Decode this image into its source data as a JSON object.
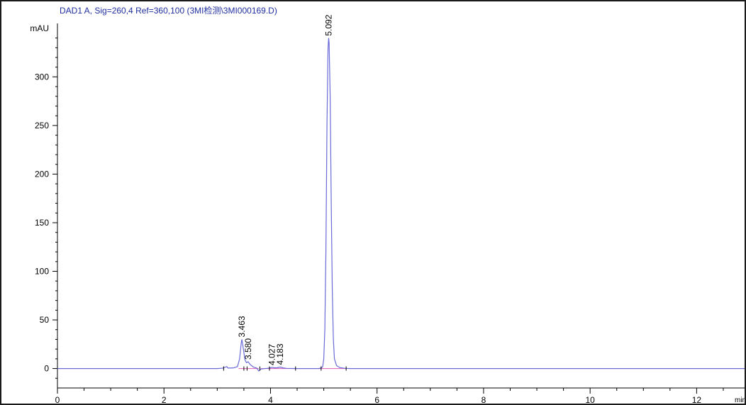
{
  "chart_data": {
    "type": "line",
    "title": "DAD1 A, Sig=260,4 Ref=360,100 (3MI检测\\3MI000169.D)",
    "ylabel": "mAU",
    "xlabel": "min",
    "xlim": [
      0,
      12.9
    ],
    "ylim": [
      -20,
      355
    ],
    "x_ticks": [
      0,
      2,
      4,
      6,
      8,
      10,
      12
    ],
    "y_ticks": [
      0,
      50,
      100,
      150,
      200,
      250,
      300
    ],
    "grid": false,
    "series": [
      {
        "color": "#6a6ad8",
        "points": [
          [
            0,
            0
          ],
          [
            3.0,
            0
          ],
          [
            3.1,
            0.4
          ],
          [
            3.18,
            2.0
          ],
          [
            3.2,
            0.5
          ],
          [
            3.3,
            0.6
          ],
          [
            3.38,
            2
          ],
          [
            3.42,
            10
          ],
          [
            3.45,
            26
          ],
          [
            3.463,
            30
          ],
          [
            3.48,
            24
          ],
          [
            3.52,
            9
          ],
          [
            3.55,
            6
          ],
          [
            3.58,
            7
          ],
          [
            3.62,
            4
          ],
          [
            3.68,
            1.5
          ],
          [
            3.74,
            0.5
          ],
          [
            3.78,
            -2.5
          ],
          [
            3.82,
            -0.5
          ],
          [
            3.9,
            0
          ],
          [
            3.97,
            0.4
          ],
          [
            4.027,
            1.2
          ],
          [
            4.08,
            0.7
          ],
          [
            4.13,
            0.9
          ],
          [
            4.183,
            1.5
          ],
          [
            4.24,
            0.6
          ],
          [
            4.3,
            0.2
          ],
          [
            4.5,
            0
          ],
          [
            4.9,
            0
          ],
          [
            4.95,
            0.5
          ],
          [
            4.98,
            2
          ],
          [
            5.0,
            10
          ],
          [
            5.02,
            40
          ],
          [
            5.04,
            120
          ],
          [
            5.06,
            250
          ],
          [
            5.08,
            330
          ],
          [
            5.092,
            340
          ],
          [
            5.1,
            335
          ],
          [
            5.12,
            280
          ],
          [
            5.14,
            170
          ],
          [
            5.16,
            80
          ],
          [
            5.18,
            30
          ],
          [
            5.2,
            10
          ],
          [
            5.24,
            3
          ],
          [
            5.3,
            1
          ],
          [
            5.4,
            0.2
          ],
          [
            5.5,
            0
          ],
          [
            12.9,
            0
          ]
        ]
      }
    ],
    "baseline_color": "#e05bb8",
    "baselines": [
      [
        3.4,
        3.78
      ],
      [
        3.82,
        4.47
      ],
      [
        4.9,
        5.42
      ]
    ],
    "peak_labels": [
      {
        "x": 3.463,
        "y": 30,
        "label": "3.463"
      },
      {
        "x": 3.58,
        "y": 7,
        "label": "3.580"
      },
      {
        "x": 4.027,
        "y": 1.2,
        "label": "4.027"
      },
      {
        "x": 4.183,
        "y": 1.5,
        "label": "4.183"
      },
      {
        "x": 5.092,
        "y": 340,
        "label": "5.092"
      }
    ],
    "markers": [
      3.12,
      3.5,
      3.56,
      3.8,
      3.98,
      4.47,
      4.95,
      5.42
    ]
  }
}
